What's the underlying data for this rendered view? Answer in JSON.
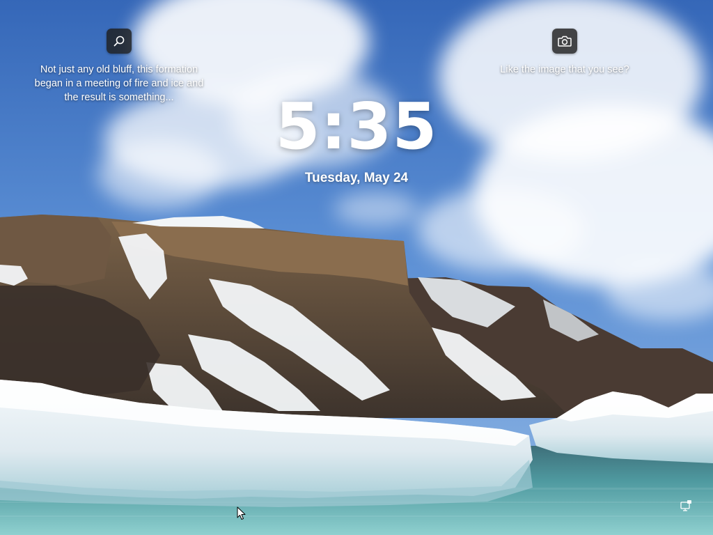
{
  "lock_screen": {
    "time": "5:35",
    "date": "Tuesday, May 24"
  },
  "spotlight": {
    "search_icon": "search-icon",
    "caption": "Not just any old bluff, this formation began in a meeting of fire and ice and the result is something...",
    "camera_icon": "camera-icon",
    "like_prompt": "Like the image that you see?"
  },
  "status": {
    "network_icon": "network-ethernet-icon"
  },
  "colors": {
    "sky": "#4a7fc9",
    "icon_button_bg": "#1e1e1e",
    "text": "#ffffff",
    "water": "#5fa7a8",
    "ice": "#eef4f7",
    "rock": "#5a4a3c"
  }
}
